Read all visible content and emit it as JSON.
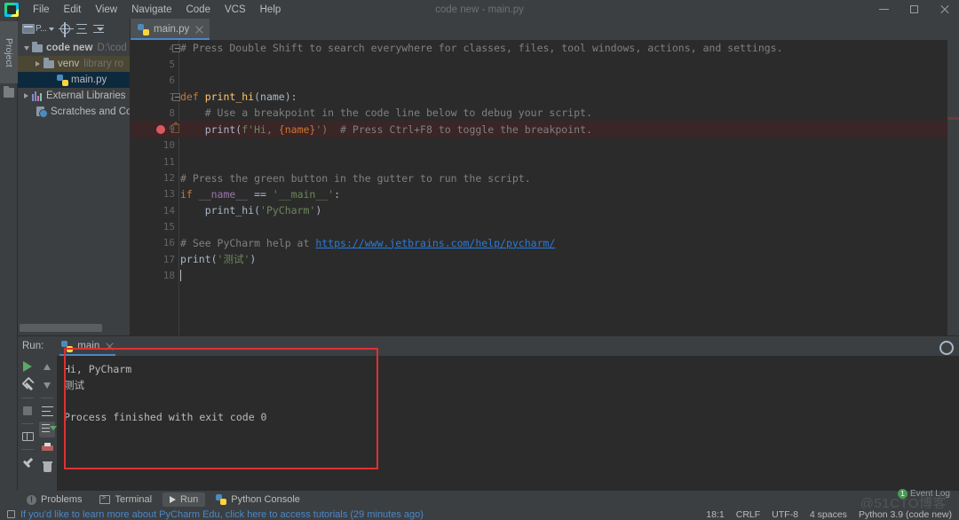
{
  "window": {
    "title": "code new - main.py",
    "app_icon": "pycharm-logo-icon",
    "controls": {
      "minimize": "minimize-icon",
      "maximize": "maximize-icon",
      "close": "close-icon"
    }
  },
  "menu": {
    "items": [
      {
        "label": "File"
      },
      {
        "label": "Edit"
      },
      {
        "label": "View"
      },
      {
        "label": "Navigate"
      },
      {
        "label": "Code"
      },
      {
        "label": "VCS"
      },
      {
        "label": "Help"
      }
    ]
  },
  "left_sidebar": {
    "project_tab": "Project"
  },
  "project_panel": {
    "selector_label": "P...",
    "toolbar": [
      "project-selector",
      "locate-target-icon",
      "collapse-all-icon",
      "expand-all-icon"
    ],
    "tree": [
      {
        "name": "code new",
        "sub": "D:\\cod",
        "icon": "folder-icon",
        "twisty": "down",
        "depth": 0,
        "bold": true,
        "state": "normal"
      },
      {
        "name": "venv",
        "sub": "library ro",
        "icon": "folder-icon",
        "twisty": "right",
        "depth": 1,
        "bold": false,
        "state": "highlight"
      },
      {
        "name": "main.py",
        "sub": "",
        "icon": "python-file-icon",
        "twisty": "none",
        "depth": 2,
        "bold": false,
        "state": "selected"
      },
      {
        "name": "External Libraries",
        "sub": "",
        "icon": "library-icon",
        "twisty": "right",
        "depth": 0,
        "bold": false,
        "state": "normal"
      },
      {
        "name": "Scratches and Cor",
        "sub": "",
        "icon": "scratches-icon",
        "twisty": "none",
        "depth": 1,
        "bold": false,
        "state": "normal"
      }
    ]
  },
  "editor": {
    "tabs": [
      {
        "label": "main.py",
        "icon": "python-file-icon",
        "active": true
      }
    ],
    "cursor_position": "18:1",
    "lines": [
      {
        "num": "4",
        "fold": true,
        "breakpoint": false,
        "highlight": false
      },
      {
        "num": "5",
        "fold": false,
        "breakpoint": false,
        "highlight": false
      },
      {
        "num": "6",
        "fold": false,
        "breakpoint": false,
        "highlight": false
      },
      {
        "num": "7",
        "fold": true,
        "breakpoint": false,
        "highlight": false
      },
      {
        "num": "8",
        "fold": false,
        "breakpoint": false,
        "highlight": false
      },
      {
        "num": "9",
        "fold": false,
        "breakpoint": true,
        "highlight": true
      },
      {
        "num": "10",
        "fold": false,
        "breakpoint": false,
        "highlight": false
      },
      {
        "num": "11",
        "fold": false,
        "breakpoint": false,
        "highlight": false
      },
      {
        "num": "12",
        "fold": false,
        "breakpoint": false,
        "highlight": false
      },
      {
        "num": "13",
        "fold": false,
        "breakpoint": false,
        "highlight": false
      },
      {
        "num": "14",
        "fold": false,
        "breakpoint": false,
        "highlight": false
      },
      {
        "num": "15",
        "fold": false,
        "breakpoint": false,
        "highlight": false
      },
      {
        "num": "16",
        "fold": false,
        "breakpoint": false,
        "highlight": false
      },
      {
        "num": "17",
        "fold": false,
        "breakpoint": false,
        "highlight": false
      },
      {
        "num": "18",
        "fold": false,
        "breakpoint": false,
        "highlight": false
      }
    ],
    "code": {
      "l4": "# Press Double Shift to search everywhere for classes, files, tool windows, actions, and settings.",
      "l7_kw": "def ",
      "l7_fn": "print_hi",
      "l7_rest": "(name):",
      "l8": "    # Use a breakpoint in the code line below to debug your script.",
      "l9_call": "    print(",
      "l9_f": "f'Hi, ",
      "l9_var": "{name}",
      "l9_end": "')",
      "l9_com": "  # Press Ctrl+F8 to toggle the breakpoint.",
      "l12": "# Press the green button in the gutter to run the script.",
      "l13_kw": "if ",
      "l13_id": "__name__",
      "l13_op": " == ",
      "l13_str": "'__main__'",
      "l13_colon": ":",
      "l14_fn": "    print_hi(",
      "l14_str": "'PyCharm'",
      "l14_end": ")",
      "l16_com": "# See PyCharm help at ",
      "l16_url": "https://www.jetbrains.com/help/pycharm/",
      "l17_fn": "print(",
      "l17_str": "'测试'",
      "l17_end": ")"
    }
  },
  "run_panel": {
    "label": "Run:",
    "tab": {
      "label": "main",
      "icon": "python-file-icon",
      "close": "close-icon"
    },
    "settings_icon": "gear-icon",
    "toolbar_primary": [
      "rerun-play-icon",
      "debug-wrench-icon",
      "stop-icon",
      "layout-icon",
      "pin-icon"
    ],
    "toolbar_secondary": [
      "up-arrow-icon",
      "down-arrow-icon",
      "soft-wrap-icon",
      "scroll-to-end-icon",
      "print-icon",
      "clear-all-trash-icon"
    ],
    "console_output": [
      "Hi, PyCharm",
      "测试",
      "",
      "Process finished with exit code 0"
    ],
    "highlight_box_color": "#e03030"
  },
  "bottom_tabs": [
    {
      "label": "Problems",
      "icon": "problems-icon",
      "active": false
    },
    {
      "label": "Terminal",
      "icon": "terminal-icon",
      "active": false
    },
    {
      "label": "Run",
      "icon": "run-play-icon",
      "active": true
    },
    {
      "label": "Python Console",
      "icon": "python-console-icon",
      "active": false
    }
  ],
  "status_bar": {
    "message": "If you'd like to learn more about PyCharm Edu, click here to access tutorials (29 minutes ago)",
    "message_color": "#4a88c7",
    "right_items": [
      {
        "label": "18:1"
      },
      {
        "label": "CRLF"
      },
      {
        "label": "UTF-8"
      },
      {
        "label": "4 spaces"
      },
      {
        "label": "Python 3.9 (code new)"
      }
    ],
    "event_log": {
      "label": "Event Log",
      "badge": "1",
      "badge_color": "#499c54"
    },
    "watermark": "@51CTO博客"
  }
}
